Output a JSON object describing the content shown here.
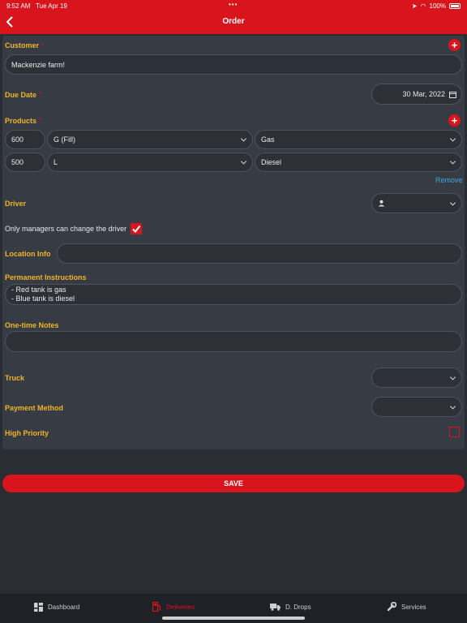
{
  "status": {
    "time": "9:52 AM",
    "date": "Tue Apr 19",
    "battery": "100%"
  },
  "header": {
    "title": "Order"
  },
  "form": {
    "customer_label": "Customer",
    "customer_required": "*",
    "customer_value": "Mackenzie farm!",
    "due_date_label": "Due Date",
    "due_date_required": "*",
    "due_date_value": "30 Mar, 2022",
    "products_label": "Products",
    "products_required": "*",
    "products": [
      {
        "qty": "600",
        "unit": "G (Fill)",
        "product": "Gas"
      },
      {
        "qty": "500",
        "unit": "L",
        "product": "Diesel"
      }
    ],
    "remove_label": "Remove",
    "driver_label": "Driver",
    "managers_note": "Only managers can change the driver",
    "managers_checked": true,
    "location_label": "Location Info",
    "location_value": "",
    "instructions_label": "Permanent Instructions",
    "instructions_line1": "- Red tank is gas",
    "instructions_line2": "- Blue tank is diesel",
    "notes_label": "One-time Notes",
    "notes_value": "",
    "truck_label": "Truck",
    "payment_label": "Payment Method",
    "priority_label": "High Priority",
    "priority_checked": false
  },
  "save_label": "SAVE",
  "tabs": [
    {
      "label": "Dashboard",
      "icon": "dashboard-icon"
    },
    {
      "label": "Deliveries",
      "icon": "fuel-pump-icon",
      "active": true
    },
    {
      "label": "D. Drops",
      "icon": "truck-icon"
    },
    {
      "label": "Services",
      "icon": "wrench-icon"
    }
  ],
  "colors": {
    "accent": "#d8141d",
    "label": "#f0b429",
    "link": "#3ea9de",
    "background": "#2a2d33",
    "card": "#373b43"
  }
}
